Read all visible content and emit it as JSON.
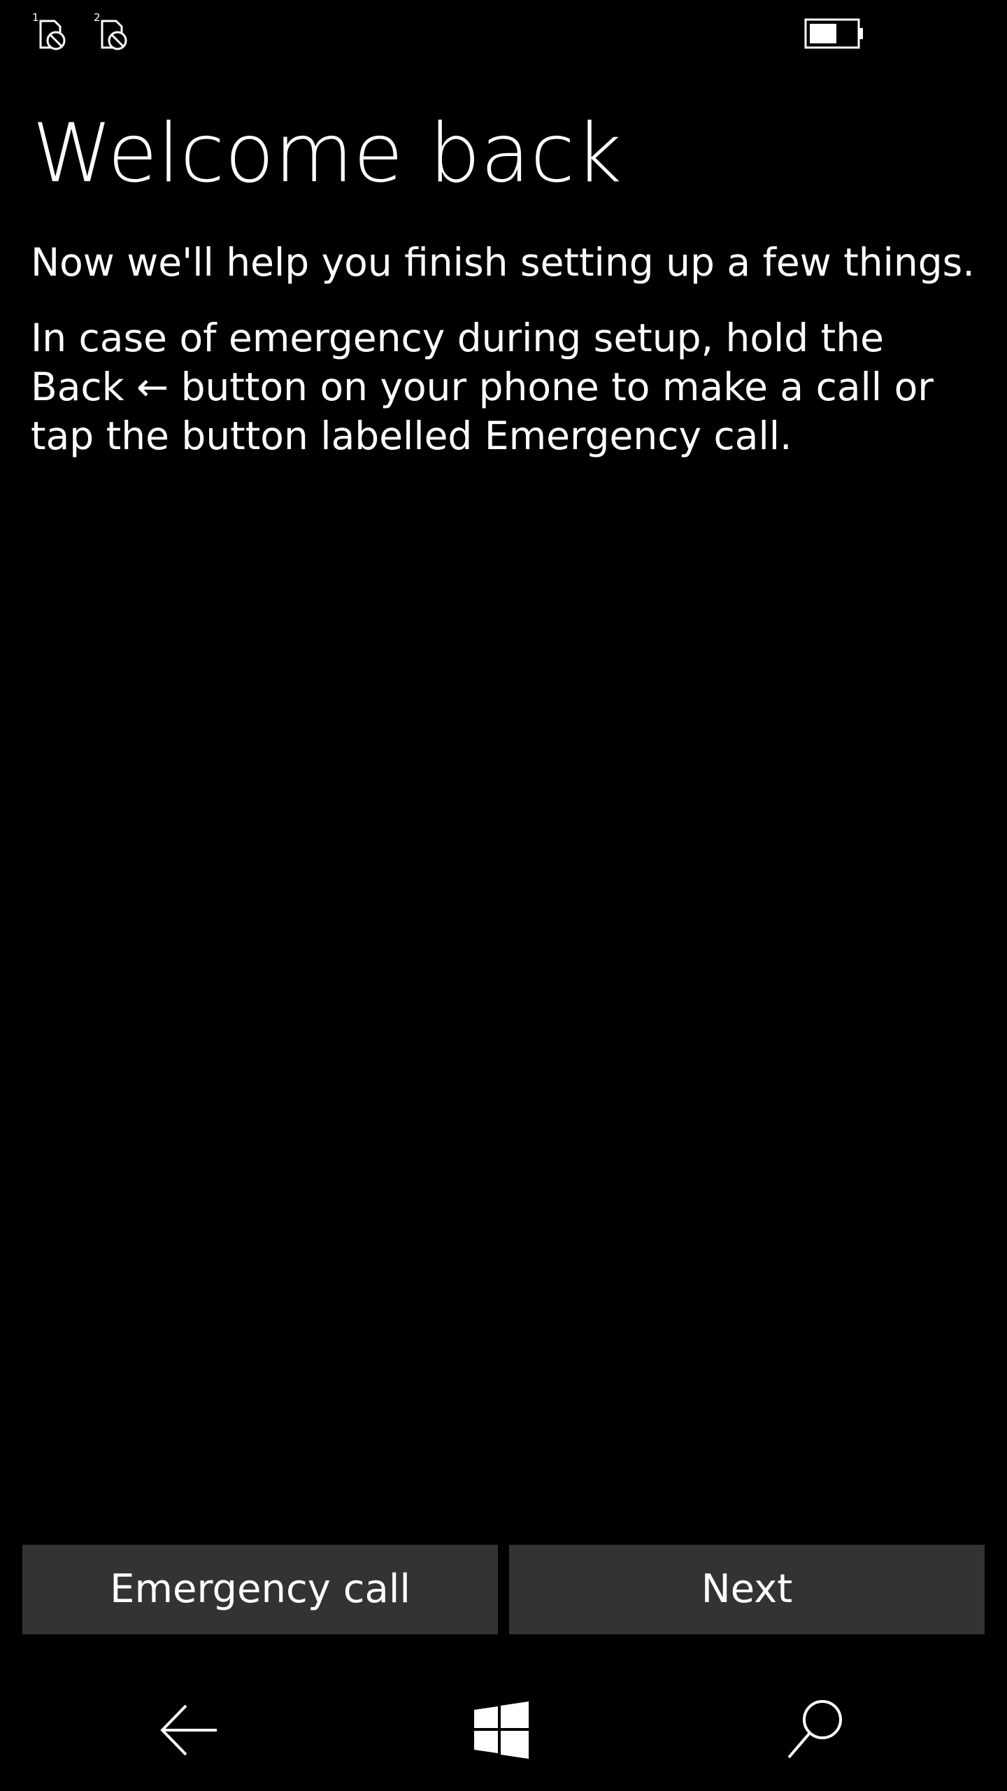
{
  "status_bar": {
    "sim1_icon": "sim-1-no-service-icon",
    "sim1_label": "1",
    "sim2_icon": "sim-2-no-service-icon",
    "sim2_label": "2",
    "battery_icon": "battery-icon",
    "battery_level": 0.6
  },
  "main": {
    "title": "Welcome back",
    "paragraph1": "Now we'll help you finish setting up a few things.",
    "paragraph2": "In case of emergency during setup, hold the Back ← button on your phone to make a call or tap the button labelled Emergency call."
  },
  "buttons": {
    "emergency_label": "Emergency call",
    "next_label": "Next"
  },
  "navbar": {
    "back_icon": "back-arrow-icon",
    "home_icon": "windows-logo-icon",
    "search_icon": "search-icon"
  },
  "colors": {
    "background": "#000000",
    "text": "#ffffff",
    "button": "#333333"
  }
}
